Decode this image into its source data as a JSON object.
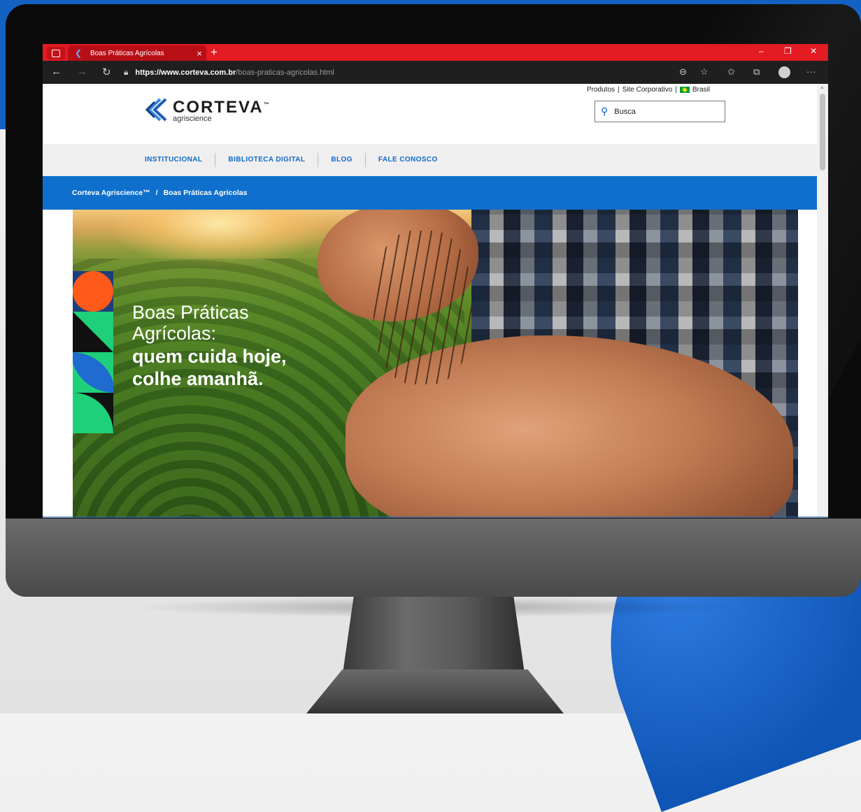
{
  "browser": {
    "tab_title": "Boas Práticas Agrícolas",
    "tab_close": "×",
    "new_tab": "+",
    "window_controls": {
      "minimize": "–",
      "restore": "❐",
      "close": "✕"
    },
    "url_host": "https://www.corteva.com.br",
    "url_path": "/boas-praticas-agricolas.html",
    "toolbar_icons": [
      "back-icon",
      "forward-icon",
      "refresh-icon",
      "lock-icon",
      "zoom-icon",
      "favorite-add-icon",
      "favorites-icon",
      "collections-icon",
      "profile-icon",
      "more-icon"
    ]
  },
  "site": {
    "top_links": {
      "produtos": "Produtos",
      "site_corporativo": "Site Corporativo",
      "separator": "|",
      "brasil": "Brasil"
    },
    "logo": {
      "name": "CORTEVA",
      "tm": "™",
      "sub": "agriscience"
    },
    "search": {
      "placeholder": "Busca"
    },
    "nav": [
      "INSTITUCIONAL",
      "BIBLIOTECA DIGITAL",
      "BLOG",
      "FALE CONOSCO"
    ],
    "breadcrumb": {
      "home": "Corteva Agriscience™",
      "separator": "/",
      "current": "Boas Práticas Agrícolas"
    },
    "hero": {
      "line1a": "Boas Práticas",
      "line1b": "Agrícolas:",
      "line2a": "quem cuida hoje,",
      "line2b": "colhe amanhã."
    }
  },
  "colors": {
    "browser_red": "#e31b23",
    "brand_blue": "#0f6fcc",
    "nav_text": "#0f6ac8",
    "shape_orange": "#ff5a1a",
    "shape_green": "#1fd07a"
  }
}
